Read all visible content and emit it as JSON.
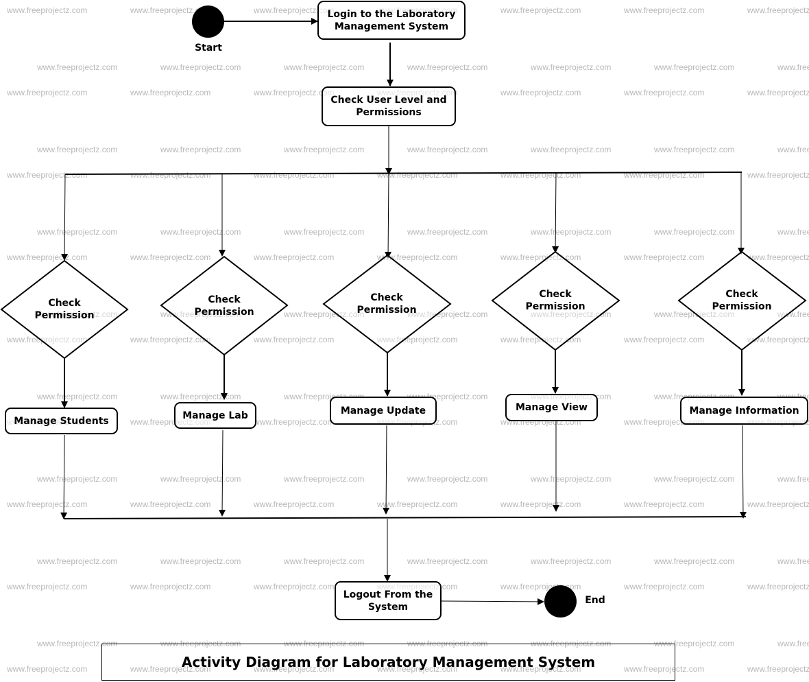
{
  "watermark": "www.freeprojectz.com",
  "start_label": "Start",
  "end_label": "End",
  "nodes": {
    "login": "Login to the Laboratory Management System",
    "check_user": "Check User Level and Permissions",
    "logout": "Logout From the System"
  },
  "branches": [
    {
      "decision": "Check Permission",
      "action": "Manage Students"
    },
    {
      "decision": "Check Permission",
      "action": "Manage Lab"
    },
    {
      "decision": "Check Permission",
      "action": "Manage Update"
    },
    {
      "decision": "Check Permission",
      "action": "Manage View"
    },
    {
      "decision": "Check Permission",
      "action": "Manage Information"
    }
  ],
  "title": "Activity Diagram for Laboratory Management System"
}
